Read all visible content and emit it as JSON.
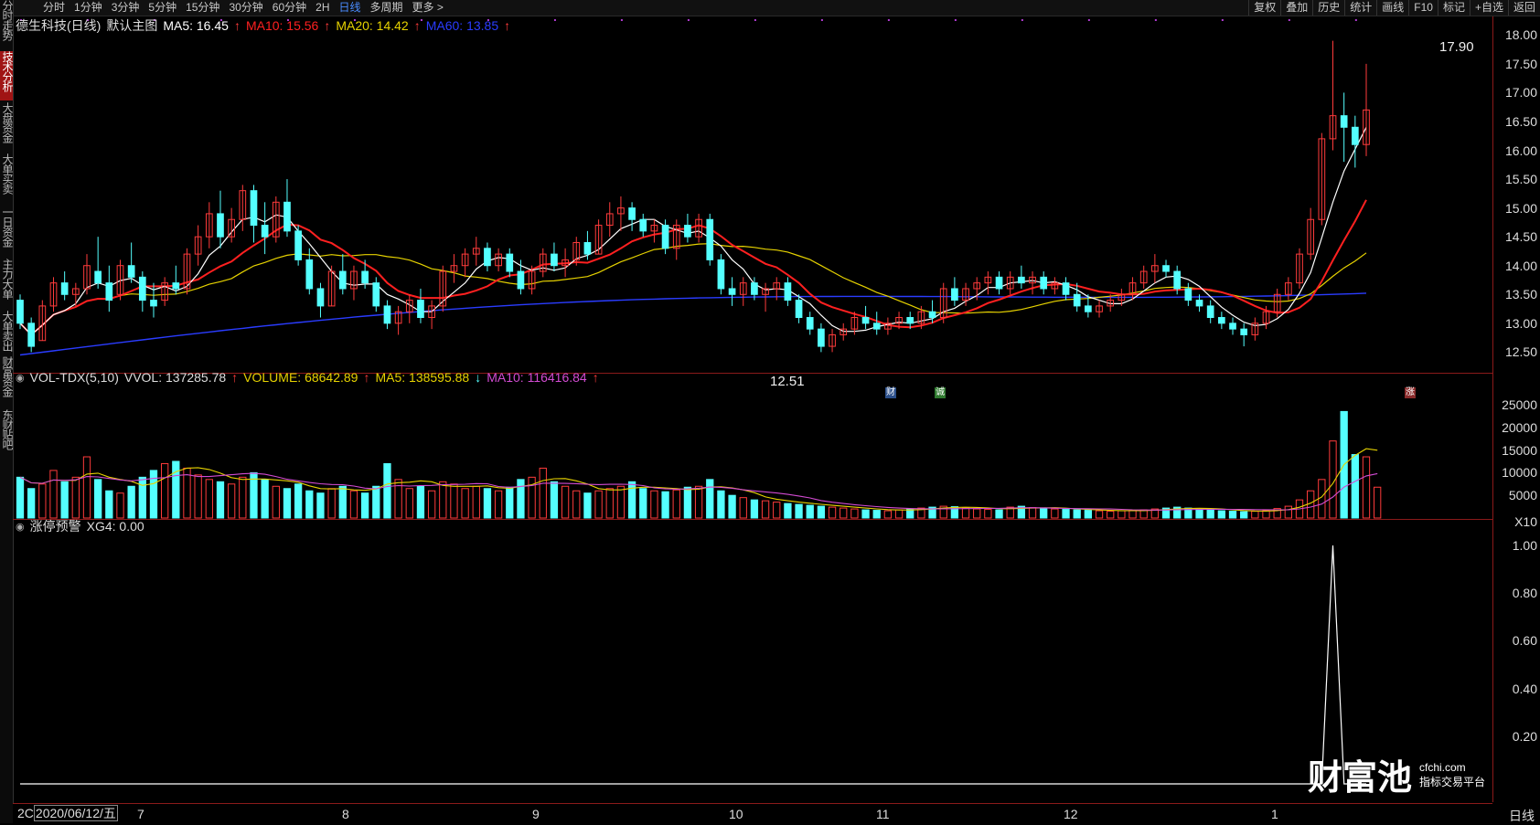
{
  "topbar": {
    "timeframes": [
      "分时",
      "1分钟",
      "3分钟",
      "5分钟",
      "15分钟",
      "30分钟",
      "60分钟",
      "2H",
      "日线",
      "多周期",
      "更多 >"
    ],
    "active_timeframe": "日线",
    "tools": [
      "复权",
      "叠加",
      "历史",
      "统计",
      "画线",
      "F10",
      "标记",
      "+自选",
      "返回"
    ]
  },
  "sidebar": {
    "items": [
      "分时走势",
      "技术分析",
      "大盘资金",
      "大单买卖",
      "一日资金",
      "主力大单",
      "大单卖出",
      "财富资金",
      "东财贴吧"
    ],
    "active": "技术分析"
  },
  "main_legend": {
    "stock": "德生科技(日线)",
    "template": "默认主图",
    "ma5": "MA5: 16.45",
    "ma10": "MA10: 15.56",
    "ma20": "MA20: 14.42",
    "ma60": "MA60: 13.85"
  },
  "volume_legend": {
    "name": "VOL-TDX(5,10)",
    "vvol": "VVOL: 137285.78",
    "volume": "VOLUME: 68642.89",
    "ma5": "MA5: 138595.88",
    "ma10": "MA10: 116416.84"
  },
  "indicator_legend": {
    "name": "涨停预警",
    "value": "XG4: 0.00"
  },
  "annotations": {
    "high": "17.90",
    "low": "12.51",
    "markers": [
      "财",
      "诚",
      "涨"
    ]
  },
  "date_label": "2020/06/12/五",
  "date_prefix": "2C",
  "x_ticks": [
    "7",
    "8",
    "9",
    "10",
    "11",
    "12",
    "1"
  ],
  "bottom_right": "日线",
  "watermark": {
    "big": "财富池",
    "url": "cfchi.com",
    "tag": "指标交易平台"
  },
  "colors": {
    "up": "#ff3b3b",
    "down": "#54ffff",
    "ma5": "#ffffff",
    "ma10": "#ff2020",
    "ma20": "#e6d200",
    "ma60": "#2a3cff",
    "vol_ma5": "#e6d200",
    "vol_ma10": "#d24bd2"
  },
  "chart_data": [
    {
      "type": "candlestick",
      "title": "德生科技(日线)",
      "y_ticks": [
        "18.00",
        "17.50",
        "17.00",
        "16.50",
        "16.00",
        "15.50",
        "15.00",
        "14.50",
        "14.00",
        "13.50",
        "13.00",
        "12.50"
      ],
      "ylim": [
        12.3,
        18.1
      ],
      "ohlc": [
        [
          13.4,
          13.5,
          12.9,
          13.0
        ],
        [
          13.0,
          13.1,
          12.5,
          12.6
        ],
        [
          12.7,
          13.4,
          12.7,
          13.3
        ],
        [
          13.3,
          13.8,
          13.2,
          13.7
        ],
        [
          13.7,
          13.9,
          13.4,
          13.5
        ],
        [
          13.5,
          13.7,
          13.3,
          13.6
        ],
        [
          13.6,
          14.2,
          13.5,
          14.0
        ],
        [
          13.9,
          14.5,
          13.6,
          13.7
        ],
        [
          13.7,
          14.0,
          13.2,
          13.4
        ],
        [
          13.5,
          14.1,
          13.4,
          14.0
        ],
        [
          14.0,
          14.4,
          13.7,
          13.8
        ],
        [
          13.8,
          13.9,
          13.2,
          13.4
        ],
        [
          13.4,
          13.7,
          13.1,
          13.3
        ],
        [
          13.4,
          13.8,
          13.3,
          13.7
        ],
        [
          13.7,
          14.0,
          13.5,
          13.6
        ],
        [
          13.6,
          14.3,
          13.5,
          14.2
        ],
        [
          14.2,
          14.7,
          14.0,
          14.5
        ],
        [
          14.5,
          15.1,
          14.3,
          14.9
        ],
        [
          14.9,
          15.3,
          14.3,
          14.5
        ],
        [
          14.5,
          15.0,
          14.4,
          14.8
        ],
        [
          14.8,
          15.4,
          14.6,
          15.3
        ],
        [
          15.3,
          15.4,
          14.4,
          14.7
        ],
        [
          14.7,
          15.1,
          14.2,
          14.5
        ],
        [
          14.5,
          15.2,
          14.4,
          15.1
        ],
        [
          15.1,
          15.5,
          14.5,
          14.6
        ],
        [
          14.6,
          14.7,
          14.0,
          14.1
        ],
        [
          14.1,
          14.3,
          13.5,
          13.6
        ],
        [
          13.6,
          13.7,
          13.1,
          13.3
        ],
        [
          13.3,
          14.0,
          13.3,
          13.9
        ],
        [
          13.9,
          14.2,
          13.5,
          13.6
        ],
        [
          13.6,
          14.0,
          13.4,
          13.9
        ],
        [
          13.9,
          14.1,
          13.6,
          13.7
        ],
        [
          13.7,
          13.8,
          13.2,
          13.3
        ],
        [
          13.3,
          13.4,
          12.9,
          13.0
        ],
        [
          13.0,
          13.3,
          12.8,
          13.2
        ],
        [
          13.2,
          13.5,
          13.0,
          13.4
        ],
        [
          13.4,
          13.6,
          13.0,
          13.1
        ],
        [
          13.1,
          13.4,
          12.9,
          13.3
        ],
        [
          13.3,
          14.0,
          13.2,
          13.9
        ],
        [
          13.9,
          14.2,
          13.7,
          14.0
        ],
        [
          14.0,
          14.3,
          13.8,
          14.2
        ],
        [
          14.2,
          14.5,
          14.0,
          14.3
        ],
        [
          14.3,
          14.4,
          13.9,
          14.0
        ],
        [
          14.0,
          14.3,
          13.9,
          14.2
        ],
        [
          14.2,
          14.3,
          13.8,
          13.9
        ],
        [
          13.9,
          14.1,
          13.5,
          13.6
        ],
        [
          13.6,
          14.0,
          13.5,
          13.9
        ],
        [
          13.9,
          14.3,
          13.8,
          14.2
        ],
        [
          14.2,
          14.4,
          13.9,
          14.0
        ],
        [
          14.0,
          14.3,
          13.8,
          14.1
        ],
        [
          14.1,
          14.5,
          14.0,
          14.4
        ],
        [
          14.4,
          14.6,
          14.1,
          14.2
        ],
        [
          14.2,
          14.8,
          14.2,
          14.7
        ],
        [
          14.7,
          15.1,
          14.5,
          14.9
        ],
        [
          14.9,
          15.2,
          14.6,
          15.0
        ],
        [
          15.0,
          15.1,
          14.6,
          14.8
        ],
        [
          14.8,
          14.9,
          14.5,
          14.6
        ],
        [
          14.6,
          14.8,
          14.4,
          14.7
        ],
        [
          14.7,
          14.8,
          14.2,
          14.3
        ],
        [
          14.3,
          14.8,
          14.1,
          14.7
        ],
        [
          14.7,
          14.9,
          14.4,
          14.5
        ],
        [
          14.5,
          14.9,
          14.4,
          14.8
        ],
        [
          14.8,
          14.9,
          14.0,
          14.1
        ],
        [
          14.1,
          14.2,
          13.5,
          13.6
        ],
        [
          13.6,
          13.8,
          13.3,
          13.5
        ],
        [
          13.5,
          13.8,
          13.3,
          13.7
        ],
        [
          13.7,
          13.8,
          13.4,
          13.5
        ],
        [
          13.5,
          13.7,
          13.2,
          13.6
        ],
        [
          13.6,
          13.8,
          13.4,
          13.7
        ],
        [
          13.7,
          13.8,
          13.3,
          13.4
        ],
        [
          13.4,
          13.5,
          13.0,
          13.1
        ],
        [
          13.1,
          13.2,
          12.8,
          12.9
        ],
        [
          12.9,
          13.0,
          12.5,
          12.6
        ],
        [
          12.6,
          12.9,
          12.5,
          12.8
        ],
        [
          12.8,
          13.0,
          12.7,
          12.9
        ],
        [
          12.9,
          13.2,
          12.8,
          13.1
        ],
        [
          13.1,
          13.3,
          12.9,
          13.0
        ],
        [
          13.0,
          13.2,
          12.8,
          12.9
        ],
        [
          12.9,
          13.1,
          12.8,
          13.0
        ],
        [
          13.0,
          13.2,
          12.9,
          13.1
        ],
        [
          13.1,
          13.2,
          12.9,
          13.0
        ],
        [
          13.0,
          13.3,
          12.9,
          13.2
        ],
        [
          13.2,
          13.4,
          13.0,
          13.1
        ],
        [
          13.1,
          13.7,
          13.0,
          13.6
        ],
        [
          13.6,
          13.8,
          13.3,
          13.4
        ],
        [
          13.4,
          13.7,
          13.3,
          13.6
        ],
        [
          13.6,
          13.8,
          13.4,
          13.7
        ],
        [
          13.7,
          13.9,
          13.5,
          13.8
        ],
        [
          13.8,
          13.9,
          13.5,
          13.6
        ],
        [
          13.6,
          13.9,
          13.5,
          13.8
        ],
        [
          13.8,
          14.0,
          13.6,
          13.7
        ],
        [
          13.7,
          13.9,
          13.5,
          13.8
        ],
        [
          13.8,
          13.9,
          13.5,
          13.6
        ],
        [
          13.6,
          13.8,
          13.5,
          13.7
        ],
        [
          13.7,
          13.8,
          13.4,
          13.5
        ],
        [
          13.5,
          13.7,
          13.2,
          13.3
        ],
        [
          13.3,
          13.5,
          13.1,
          13.2
        ],
        [
          13.2,
          13.4,
          13.1,
          13.3
        ],
        [
          13.3,
          13.5,
          13.2,
          13.4
        ],
        [
          13.4,
          13.6,
          13.3,
          13.5
        ],
        [
          13.5,
          13.8,
          13.4,
          13.7
        ],
        [
          13.7,
          14.0,
          13.6,
          13.9
        ],
        [
          13.9,
          14.2,
          13.7,
          14.0
        ],
        [
          14.0,
          14.1,
          13.8,
          13.9
        ],
        [
          13.9,
          14.0,
          13.5,
          13.6
        ],
        [
          13.6,
          13.7,
          13.3,
          13.4
        ],
        [
          13.4,
          13.5,
          13.2,
          13.3
        ],
        [
          13.3,
          13.4,
          13.0,
          13.1
        ],
        [
          13.1,
          13.2,
          12.9,
          13.0
        ],
        [
          13.0,
          13.1,
          12.8,
          12.9
        ],
        [
          12.9,
          13.0,
          12.6,
          12.8
        ],
        [
          12.8,
          13.1,
          12.7,
          13.0
        ],
        [
          13.0,
          13.3,
          12.9,
          13.2
        ],
        [
          13.2,
          13.6,
          13.1,
          13.5
        ],
        [
          13.5,
          13.8,
          13.4,
          13.7
        ],
        [
          13.7,
          14.3,
          13.6,
          14.2
        ],
        [
          14.2,
          15.0,
          14.1,
          14.8
        ],
        [
          14.8,
          16.3,
          14.7,
          16.2
        ],
        [
          16.2,
          17.9,
          16.0,
          16.6
        ],
        [
          16.6,
          17.0,
          15.8,
          16.4
        ],
        [
          16.4,
          16.6,
          15.7,
          16.1
        ],
        [
          16.1,
          17.5,
          15.9,
          16.7
        ]
      ],
      "ma5_last": 16.45,
      "ma10_last": 15.56,
      "ma20_last": 14.42,
      "ma60_last": 13.85
    },
    {
      "type": "bar",
      "title": "VOL-TDX(5,10)",
      "y_ticks": [
        "25000",
        "20000",
        "15000",
        "10000",
        "5000",
        "X10"
      ],
      "ylim": [
        0,
        26000
      ],
      "values": [
        9000,
        6500,
        7500,
        10500,
        8000,
        9000,
        13500,
        8500,
        6000,
        5500,
        7000,
        9000,
        10500,
        12000,
        12500,
        11000,
        9500,
        8500,
        8000,
        7500,
        9000,
        10000,
        8500,
        7000,
        6500,
        7500,
        6000,
        5500,
        6500,
        7000,
        6000,
        5500,
        7000,
        12000,
        8500,
        6500,
        7000,
        6000,
        8000,
        7500,
        6500,
        7000,
        6500,
        6000,
        6800,
        8500,
        9000,
        11000,
        8000,
        7000,
        6000,
        5500,
        6000,
        6500,
        7000,
        8000,
        6500,
        6000,
        5800,
        6200,
        6800,
        7000,
        8500,
        6000,
        5000,
        4500,
        4000,
        3800,
        3500,
        3200,
        3000,
        2800,
        2600,
        2400,
        2200,
        2000,
        1800,
        1700,
        1600,
        1800,
        2000,
        2200,
        2400,
        2600,
        2500,
        2200,
        2000,
        1900,
        1800,
        2400,
        2600,
        2300,
        2100,
        2000,
        1900,
        1800,
        1700,
        1600,
        1500,
        1600,
        1700,
        1800,
        2000,
        2200,
        2400,
        2200,
        2000,
        1800,
        1600,
        1500,
        1400,
        1500,
        1700,
        2100,
        2600,
        4000,
        6000,
        8500,
        17000,
        23500,
        14000,
        13500,
        6800
      ]
    },
    {
      "type": "line",
      "title": "涨停预警",
      "y_ticks": [
        "1.00",
        "0.80",
        "0.60",
        "0.40",
        "0.20"
      ],
      "ylim": [
        0,
        1.05
      ],
      "spike_index": 118,
      "spike_value": 1.0
    }
  ]
}
